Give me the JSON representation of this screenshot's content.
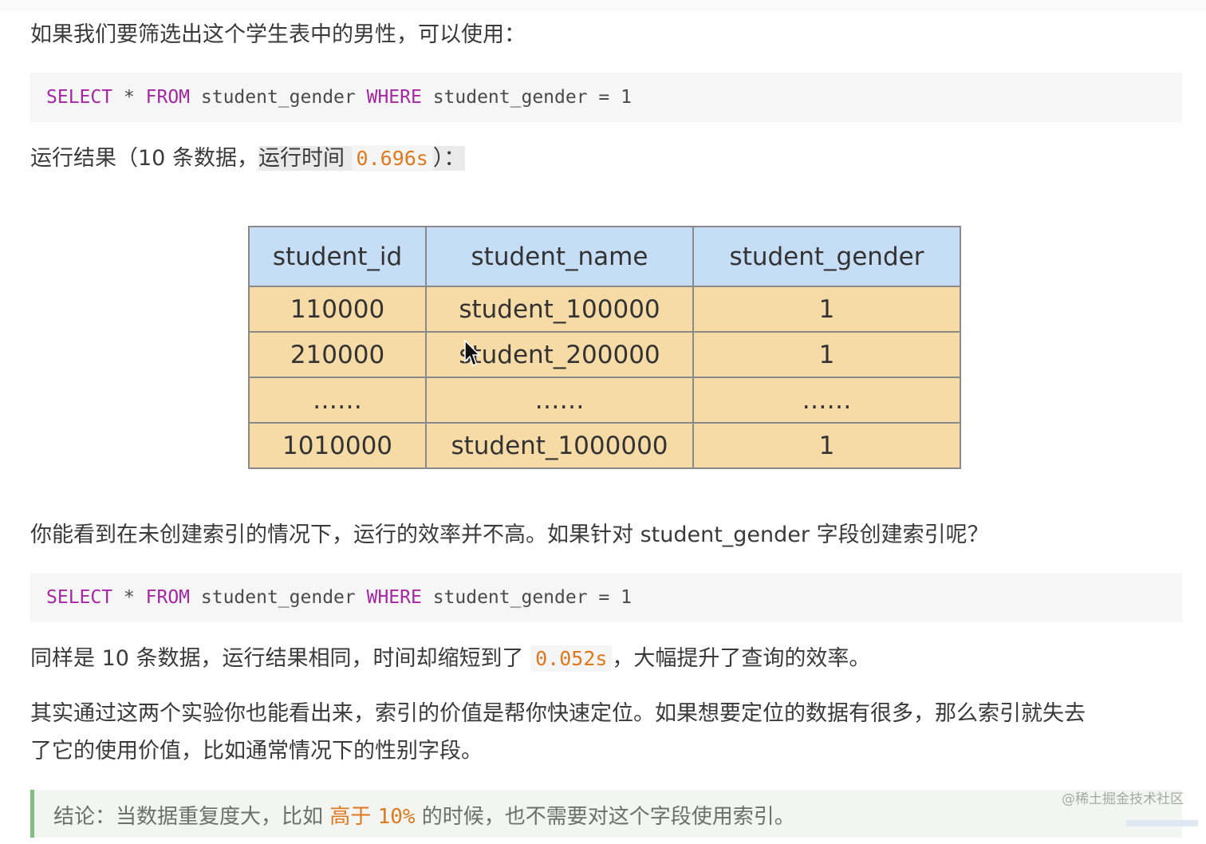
{
  "intro": "如果我们要筛选出这个学生表中的男性，可以使用：",
  "query1": {
    "select": "SELECT",
    "star": " * ",
    "from": "FROM",
    "table": " student_gender ",
    "where": "WHERE",
    "cond": " student_gender = 1"
  },
  "result1": {
    "prefix": "运行结果（10 条数据，",
    "time_label": "运行时间",
    "time_value": "0.696s",
    "suffix": "）："
  },
  "table": {
    "headers": [
      "student_id",
      "student_name",
      "student_gender"
    ],
    "rows": [
      [
        "110000",
        "student_100000",
        "1"
      ],
      [
        "210000",
        "student_200000",
        "1"
      ],
      [
        "……",
        "……",
        "……"
      ],
      [
        "1010000",
        "student_1000000",
        "1"
      ]
    ]
  },
  "para2": "你能看到在未创建索引的情况下，运行的效率并不高。如果针对 student_gender 字段创建索引呢？",
  "query2": {
    "select": "SELECT",
    "star": " * ",
    "from": "FROM",
    "table": " student_gender ",
    "where": "WHERE",
    "cond": " student_gender = 1"
  },
  "result2": {
    "prefix": "同样是 10 条数据，运行结果相同，时间却缩短到了 ",
    "time_value": "0.052s",
    "suffix": "，大幅提升了查询的效率。"
  },
  "para3_line1": "其实通过这两个实验你也能看出来，索引的价值是帮你快速定位。如果想要定位的数据有很多，那么索引就失去",
  "para3_line2": "了它的使用价值，比如通常情况下的性别字段。",
  "conclusion": {
    "prefix": "结论：当数据重复度大，比如",
    "high": "高于",
    "pct": "10%",
    "suffix": "的时候，也不需要对这个字段使用索引。"
  },
  "watermark": "@稀土掘金技术社区",
  "colors": {
    "keyword": "#a626a4",
    "inline_code": "#e0781c",
    "table_header": "#c6ddf6",
    "table_cell": "#f6dba6"
  }
}
